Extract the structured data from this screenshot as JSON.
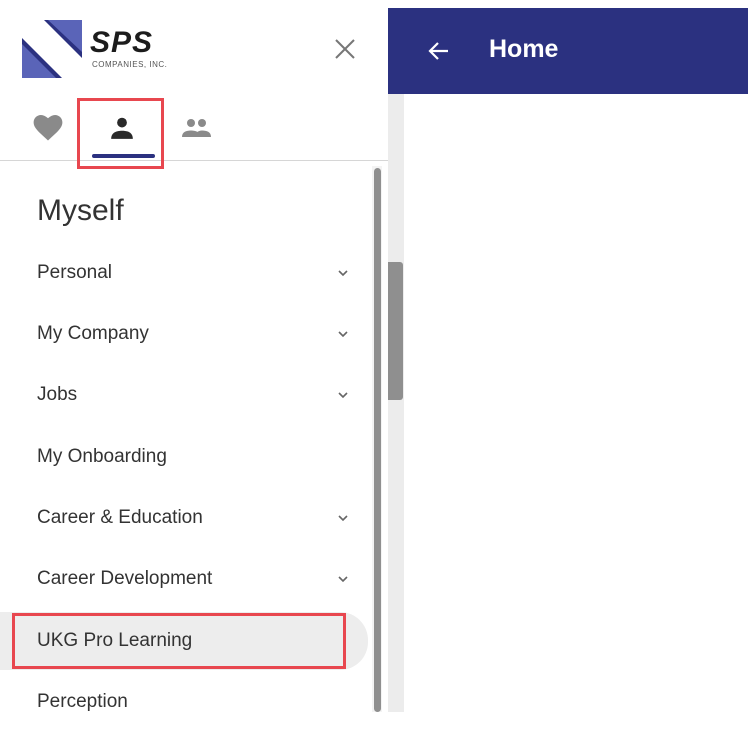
{
  "logo": {
    "name": "SPS",
    "sub": "COMPANIES, INC."
  },
  "tabs": [
    {
      "id": "favorites",
      "icon": "heart-icon"
    },
    {
      "id": "myself",
      "icon": "person-icon",
      "selected": true
    },
    {
      "id": "team",
      "icon": "people-icon"
    }
  ],
  "sidebar": {
    "section_title": "Myself",
    "items": [
      {
        "label": "Personal",
        "expandable": true
      },
      {
        "label": "My Company",
        "expandable": true
      },
      {
        "label": "Jobs",
        "expandable": true
      },
      {
        "label": "My Onboarding",
        "expandable": false
      },
      {
        "label": "Career & Education",
        "expandable": true
      },
      {
        "label": "Career Development",
        "expandable": true
      },
      {
        "label": "UKG Pro Learning",
        "expandable": false,
        "active": true
      },
      {
        "label": "Perception",
        "expandable": false
      }
    ]
  },
  "header": {
    "title": "Home"
  },
  "colors": {
    "brand": "#2b3180",
    "highlight": "#e8474f",
    "text": "#333333"
  }
}
